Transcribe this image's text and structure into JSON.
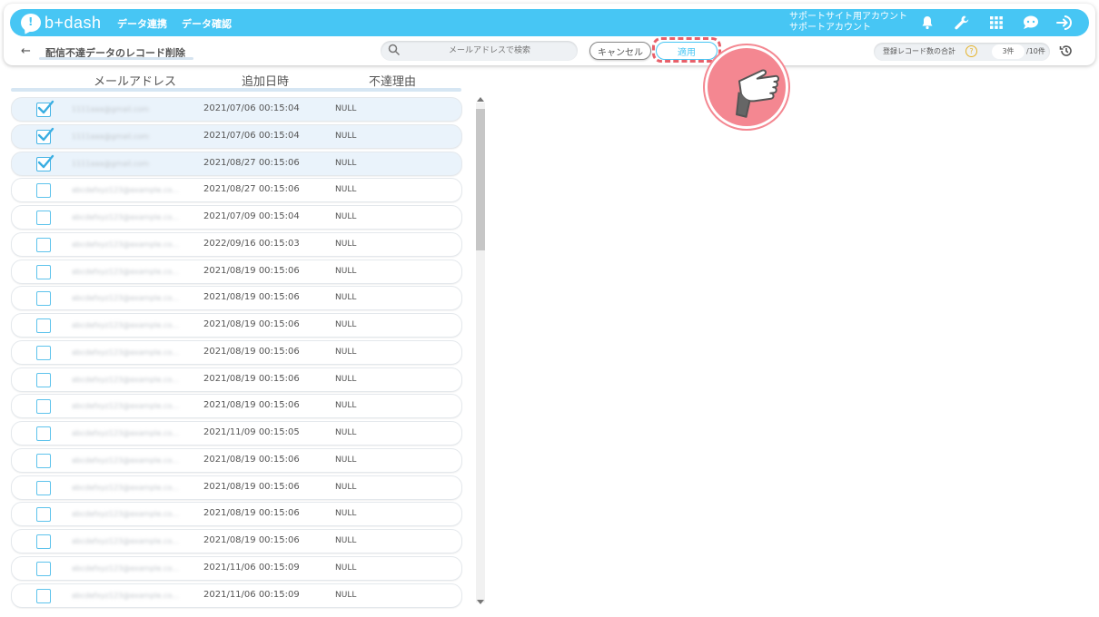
{
  "app": {
    "brand": "b+dash",
    "nav": [
      "データ連携",
      "データ確認"
    ],
    "account_line1": "サポートサイト用アカウント",
    "account_line2": "サポートアカウント",
    "top_icons": [
      "bell-icon",
      "wrench-icon",
      "grid-icon",
      "chat-icon",
      "logout-icon"
    ]
  },
  "toolbar": {
    "back_icon": "←",
    "page_title": "配信不達データのレコード削除",
    "search_placeholder": "メールアドレスで検索",
    "cancel_label": "キャンセル",
    "apply_label": "適用",
    "record_count_label": "登録レコード数の合計",
    "help_icon": "?",
    "selected_count": "3件",
    "total_count": "/10件"
  },
  "table": {
    "headers": [
      "メールアドレス",
      "追加日時",
      "不達理由"
    ],
    "rows": [
      {
        "checked": true,
        "email": "1111aaa@gmail.com",
        "datetime": "2021/07/06 00:15:04",
        "reason": "NULL"
      },
      {
        "checked": true,
        "email": "1111aaa@gmail.com",
        "datetime": "2021/07/06 00:15:04",
        "reason": "NULL"
      },
      {
        "checked": true,
        "email": "1111aaa@gmail.com",
        "datetime": "2021/08/27 00:15:06",
        "reason": "NULL"
      },
      {
        "checked": false,
        "email": "abcdefxyz123@example.co...",
        "datetime": "2021/08/27 00:15:06",
        "reason": "NULL"
      },
      {
        "checked": false,
        "email": "abcdefxyz123@example.co...",
        "datetime": "2021/07/09 00:15:04",
        "reason": "NULL"
      },
      {
        "checked": false,
        "email": "abcdefxyz123@example.co...",
        "datetime": "2022/09/16 00:15:03",
        "reason": "NULL"
      },
      {
        "checked": false,
        "email": "abcdefxyz123@example.co...",
        "datetime": "2021/08/19 00:15:06",
        "reason": "NULL"
      },
      {
        "checked": false,
        "email": "abcdefxyz123@example.co...",
        "datetime": "2021/08/19 00:15:06",
        "reason": "NULL"
      },
      {
        "checked": false,
        "email": "abcdefxyz123@example.co...",
        "datetime": "2021/08/19 00:15:06",
        "reason": "NULL"
      },
      {
        "checked": false,
        "email": "abcdefxyz123@example.co...",
        "datetime": "2021/08/19 00:15:06",
        "reason": "NULL"
      },
      {
        "checked": false,
        "email": "abcdefxyz123@example.co...",
        "datetime": "2021/08/19 00:15:06",
        "reason": "NULL"
      },
      {
        "checked": false,
        "email": "abcdefxyz123@example.co...",
        "datetime": "2021/08/19 00:15:06",
        "reason": "NULL"
      },
      {
        "checked": false,
        "email": "abcdefxyz123@example.co...",
        "datetime": "2021/11/09 00:15:05",
        "reason": "NULL"
      },
      {
        "checked": false,
        "email": "abcdefxyz123@example.co...",
        "datetime": "2021/08/19 00:15:06",
        "reason": "NULL"
      },
      {
        "checked": false,
        "email": "abcdefxyz123@example.co...",
        "datetime": "2021/08/19 00:15:06",
        "reason": "NULL"
      },
      {
        "checked": false,
        "email": "abcdefxyz123@example.co...",
        "datetime": "2021/08/19 00:15:06",
        "reason": "NULL"
      },
      {
        "checked": false,
        "email": "abcdefxyz123@example.co...",
        "datetime": "2021/08/19 00:15:06",
        "reason": "NULL"
      },
      {
        "checked": false,
        "email": "abcdefxyz123@example.co...",
        "datetime": "2021/11/06 00:15:09",
        "reason": "NULL"
      },
      {
        "checked": false,
        "email": "abcdefxyz123@example.co...",
        "datetime": "2021/11/06 00:15:09",
        "reason": "NULL"
      }
    ]
  },
  "colors": {
    "accent": "#47c6f4",
    "highlight": "#e8606a",
    "row_selected": "#eaf3fb"
  },
  "overlay": {
    "pointer": "hand-pointer-icon"
  }
}
